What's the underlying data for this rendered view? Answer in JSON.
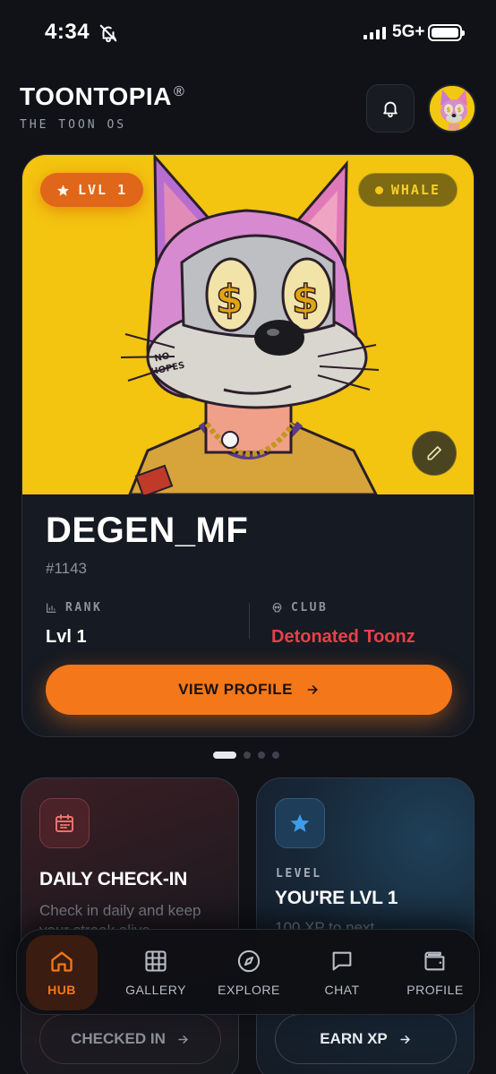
{
  "status_bar": {
    "time": "4:34",
    "network": "5G+"
  },
  "header": {
    "brand": "TOONTOPIA",
    "registered": "®",
    "tagline": "THE TOON OS"
  },
  "hero_card": {
    "level_badge": "LVL 1",
    "tier_badge": "WHALE",
    "name": "DEGEN_MF",
    "token_number": "#1143",
    "rank_label": "RANK",
    "rank_value": "Lvl 1",
    "club_label": "CLUB",
    "club_value": "Detonated Toonz",
    "view_profile_label": "VIEW PROFILE",
    "accent": "#f47719",
    "art_background": "#f3c410"
  },
  "carousel": {
    "pages": 4,
    "active": 1
  },
  "daily_checkin": {
    "title": "DAILY CHECK-IN",
    "description": "Check in daily and keep your streak alive",
    "action_label": "CHECKED IN"
  },
  "level_card": {
    "eyebrow": "LEVEL",
    "title": "YOU'RE LVL 1",
    "description": "100 XP to next",
    "action_label": "EARN XP"
  },
  "bottom_nav": {
    "items": [
      {
        "label": "HUB",
        "icon": "home-icon",
        "active": true
      },
      {
        "label": "GALLERY",
        "icon": "grid-icon",
        "active": false
      },
      {
        "label": "EXPLORE",
        "icon": "compass-icon",
        "active": false
      },
      {
        "label": "CHAT",
        "icon": "chat-icon",
        "active": false
      },
      {
        "label": "PROFILE",
        "icon": "wallet-icon",
        "active": false
      }
    ]
  }
}
